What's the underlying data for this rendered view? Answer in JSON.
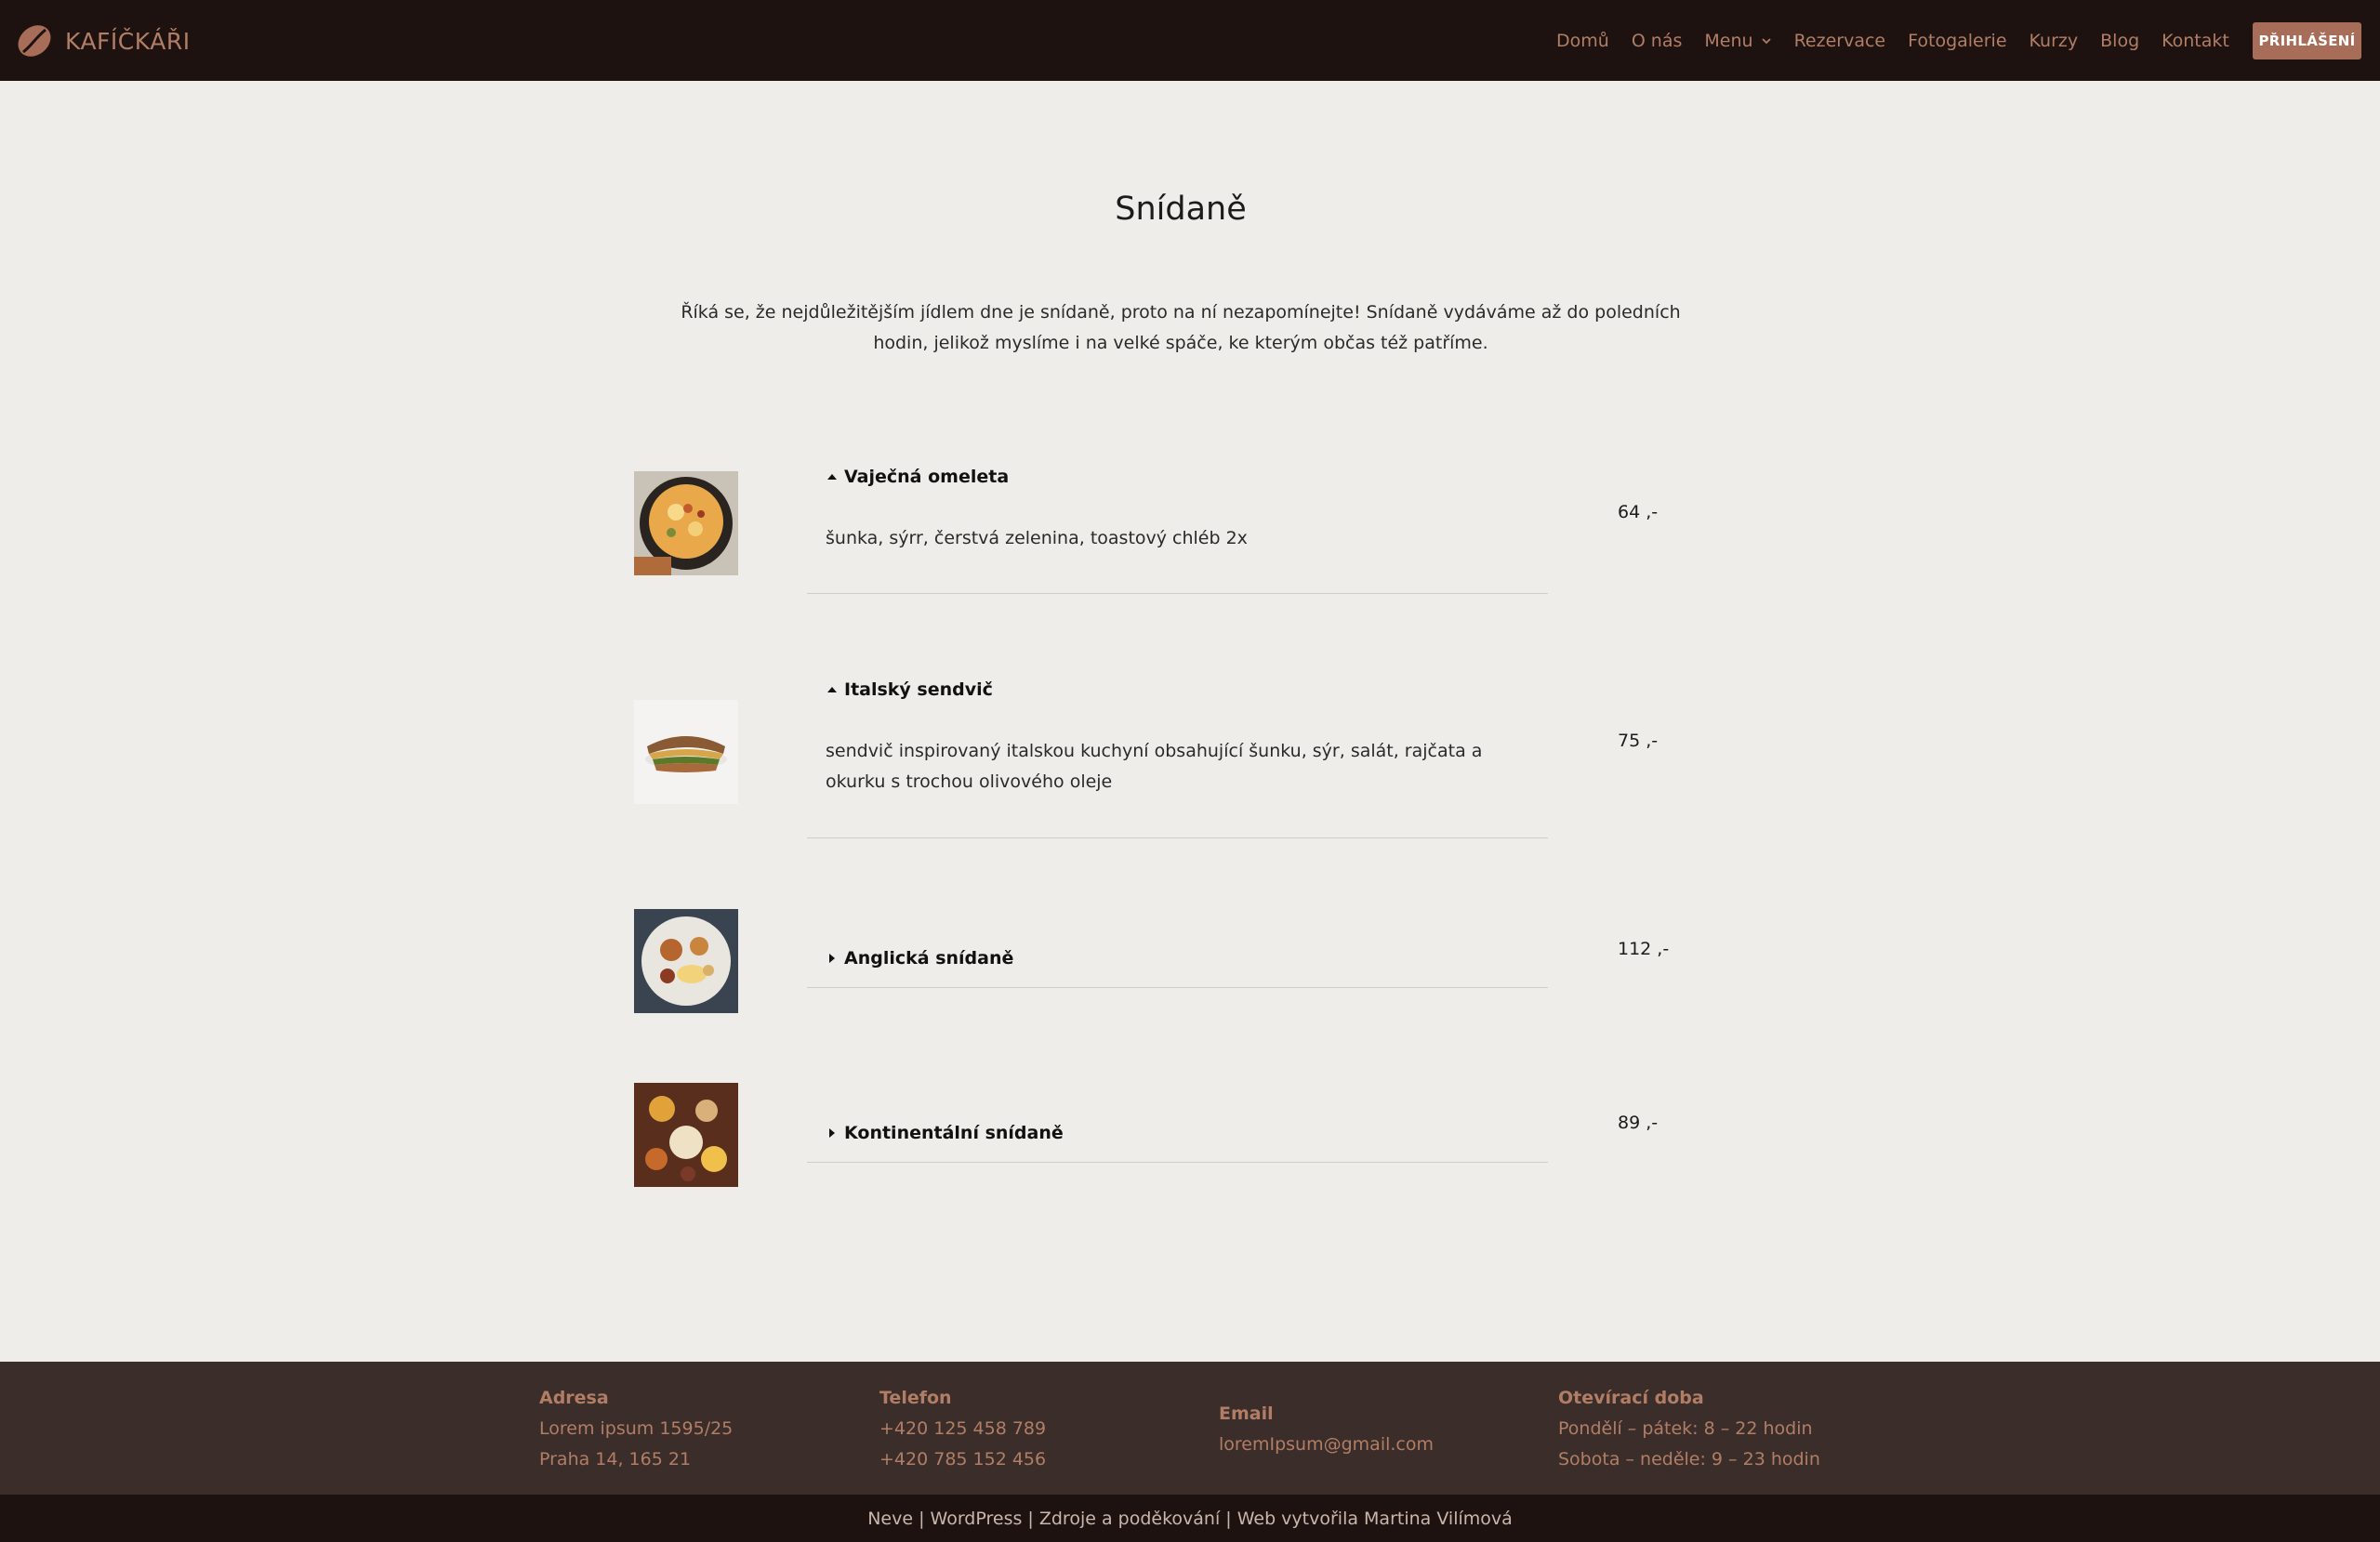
{
  "header": {
    "brand": "KAFÍČKÁŘI",
    "nav": [
      "Domů",
      "O nás",
      "Menu",
      "Rezervace",
      "Fotogalerie",
      "Kurzy",
      "Blog",
      "Kontakt"
    ],
    "login": "PŘIHLÁŠENÍ",
    "colors": {
      "bar": "#1d1210",
      "link": "#b17e65",
      "button": "#a86d58"
    }
  },
  "main": {
    "title": "Snídaně",
    "intro": "Říká se, že nejdůležitějším jídlem dne je snídaně, proto na ní nezapomínejte! Snídaně vydáváme až do poledních hodin, jelikož myslíme i na velké spáče, ke kterým občas též patříme.",
    "items": [
      {
        "name": "Vaječná omeleta",
        "desc": "šunka, sýrr, čerstvá zelenina, toastový chléb 2x",
        "price": "64 ,-",
        "expanded": true,
        "icon": "omelette-photo"
      },
      {
        "name": "Italský sendvič",
        "desc": "sendvič inspirovaný italskou kuchyní obsahující šunku, sýr, salát, rajčata a okurku s trochou olivového oleje",
        "price": "75 ,-",
        "expanded": true,
        "icon": "sandwich-photo"
      },
      {
        "name": "Anglická snídaně",
        "desc": "",
        "price": "112 ,-",
        "expanded": false,
        "icon": "english-breakfast-photo"
      },
      {
        "name": "Kontinentální snídaně",
        "desc": "",
        "price": "89 ,-",
        "expanded": false,
        "icon": "continental-breakfast-photo"
      }
    ]
  },
  "footer": {
    "address": {
      "heading": "Adresa",
      "line1": "Lorem ipsum 1595/25",
      "line2": "Praha 14, 165 21"
    },
    "phone": {
      "heading": "Telefon",
      "line1": "+420 125 458 789",
      "line2": "+420 785 152 456"
    },
    "email": {
      "heading": "Email",
      "line1": "loremIpsum@gmail.com"
    },
    "hours": {
      "heading": "Otevírací doba",
      "line1": "Pondělí – pátek: 8 – 22 hodin",
      "line2": "Sobota – neděle: 9 – 23 hodin"
    },
    "credits": "Neve | WordPress | Zdroje a poděkování | Web vytvořila Martina Vilímová",
    "colors": {
      "footer": "#3b2d2a",
      "text": "#b17e65"
    }
  }
}
